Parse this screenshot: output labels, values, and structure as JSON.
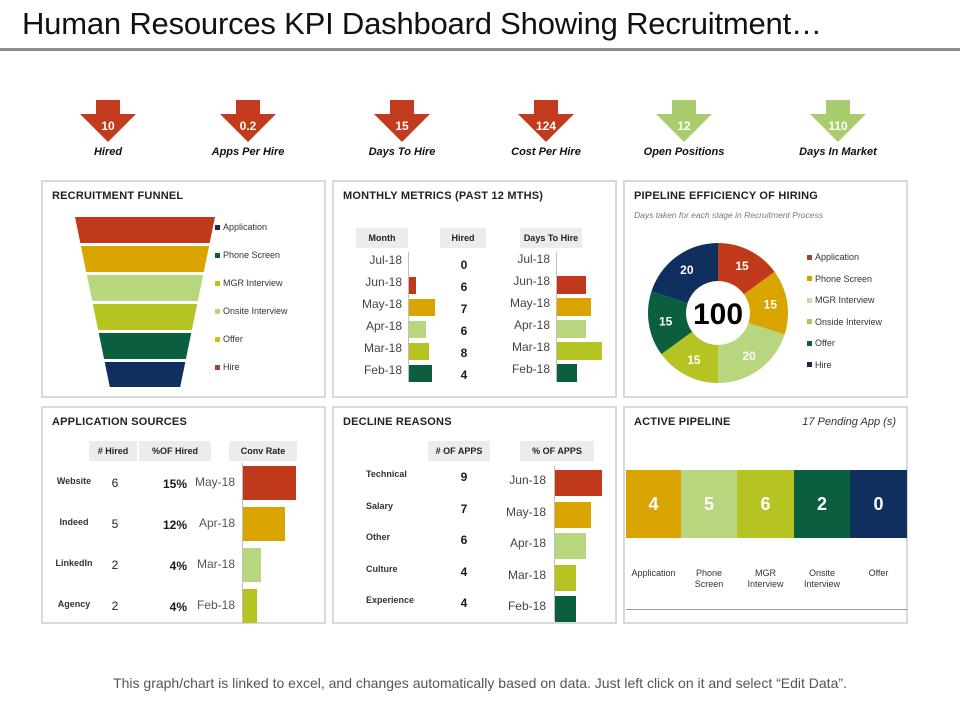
{
  "title": "Human Resources KPI Dashboard Showing Recruitment…",
  "colors": {
    "red": "#c0391b",
    "orange": "#d9a300",
    "lightgreen": "#b8d67e",
    "lime": "#b5c422",
    "darkgreen": "#0b5e3e",
    "navy": "#0f2f5e",
    "kpi_down_red": "#c23b1c",
    "kpi_down_green": "#a9cd6e"
  },
  "kpis": [
    {
      "value": "10",
      "label": "Hired",
      "color": "#c23b1c",
      "icon": "down-arrow-icon"
    },
    {
      "value": "0.2",
      "label": "Apps Per Hire",
      "color": "#c23b1c",
      "icon": "down-arrow-icon"
    },
    {
      "value": "15",
      "label": "Days To Hire",
      "color": "#c23b1c",
      "icon": "down-arrow-icon"
    },
    {
      "value": "124",
      "label": "Cost Per Hire",
      "color": "#c23b1c",
      "icon": "down-arrow-icon"
    },
    {
      "value": "12",
      "label": "Open Positions",
      "color": "#a9cd6e",
      "icon": "down-arrow-icon"
    },
    {
      "value": "110",
      "label": "Days In Market",
      "color": "#a9cd6e",
      "icon": "down-arrow-icon"
    }
  ],
  "funnel": {
    "title": "RECRUITMENT  FUNNEL",
    "stages": [
      "Application",
      "Phone Screen",
      "MGR Interview",
      "Onsite Interview",
      "Offer",
      "Hire"
    ],
    "stage_colors": [
      "#c0391b",
      "#d9a300",
      "#b8d67e",
      "#b5c422",
      "#0b5e3e",
      "#0f2f5e"
    ],
    "legend": [
      {
        "label": "Application",
        "color": "#1a2a3a"
      },
      {
        "label": "Phone Screen",
        "color": "#0b5e3e"
      },
      {
        "label": "MGR Interview",
        "color": "#b5c422"
      },
      {
        "label": "Onsite Interview",
        "color": "#b8d67e"
      },
      {
        "label": "Offer",
        "color": "#c9c222"
      },
      {
        "label": "Hire",
        "color": "#a04530"
      }
    ]
  },
  "monthly": {
    "title": "MONTHLY  METRICS  (PAST 12 MTHS)",
    "headers": {
      "month": "Month",
      "hired": "Hired",
      "days": "Days To  Hire"
    },
    "months": [
      "Jul-18",
      "Jun-18",
      "May-18",
      "Apr-18",
      "Mar-18",
      "Feb-18"
    ],
    "hired": [
      "0",
      "6",
      "7",
      "6",
      "8",
      "4"
    ],
    "bar_colors": [
      "#ffffff",
      "#c0391b",
      "#d9a300",
      "#b8d67e",
      "#b5c422",
      "#0b5e3e"
    ]
  },
  "pipeline_eff": {
    "title": "PIPELINE  EFFICIENCY  OF HIRING",
    "subtitle": "Days taken for each stage in Recruitment Process",
    "total": "100",
    "legend": [
      {
        "label": "Application",
        "color": "#a04530"
      },
      {
        "label": "Phone Screen",
        "color": "#c9a300"
      },
      {
        "label": "MGR Interview",
        "color": "#c9d9a9"
      },
      {
        "label": "Onside Interview",
        "color": "#b5c44a"
      },
      {
        "label": "Offer",
        "color": "#0b5e3e"
      },
      {
        "label": "Hire",
        "color": "#1a2a4a"
      }
    ]
  },
  "app_sources": {
    "title": "APPLICATION   SOURCES",
    "headers": {
      "hired": "# Hired",
      "pct": "%OF Hired",
      "conv": "Conv Rate"
    },
    "rows": [
      {
        "source": "Website",
        "hired": "6",
        "pct": "15%",
        "month": "May-18"
      },
      {
        "source": "Indeed",
        "hired": "5",
        "pct": "12%",
        "month": "Apr-18"
      },
      {
        "source": "LinkedIn",
        "hired": "2",
        "pct": "4%",
        "month": "Mar-18"
      },
      {
        "source": "Agency",
        "hired": "2",
        "pct": "4%",
        "month": "Feb-18"
      }
    ],
    "bar_colors": [
      "#c0391b",
      "#d9a300",
      "#b8d67e",
      "#b5c422"
    ]
  },
  "decline": {
    "title": "DECLINE   REASONS",
    "headers": {
      "apps": "# OF APPS",
      "pct": "% OF APPS"
    },
    "rows": [
      {
        "reason": "Technical",
        "apps": "9",
        "month": "Jun-18"
      },
      {
        "reason": "Salary",
        "apps": "7",
        "month": "May-18"
      },
      {
        "reason": "Other",
        "apps": "6",
        "month": "Apr-18"
      },
      {
        "reason": "Culture",
        "apps": "4",
        "month": "Mar-18"
      },
      {
        "reason": "Experience",
        "apps": "4",
        "month": "Feb-18"
      }
    ],
    "bar_colors": [
      "#c0391b",
      "#d9a300",
      "#b8d67e",
      "#b5c422",
      "#0b5e3e"
    ]
  },
  "active": {
    "title": "ACTIVE  PIPELINE",
    "pending": "17 Pending App (s)",
    "stages": [
      {
        "label": "Application",
        "value": "4",
        "color": "#d9a300"
      },
      {
        "label": "Phone\nScreen",
        "value": "5",
        "color": "#b8d67e"
      },
      {
        "label": "MGR\nInterview",
        "value": "6",
        "color": "#b5c422"
      },
      {
        "label": "Onsite\nInterview",
        "value": "2",
        "color": "#0b5e3e"
      },
      {
        "label": "Offer",
        "value": "0",
        "color": "#0f2f5e"
      }
    ]
  },
  "footer": "This graph/chart is linked to excel, and changes automatically  based on data. Just left click on it and select “Edit Data”.",
  "chart_data": [
    {
      "type": "bar",
      "title": "RECRUITMENT FUNNEL",
      "categories": [
        "Application",
        "Phone Screen",
        "MGR Interview",
        "Onsite Interview",
        "Offer",
        "Hire"
      ],
      "values": [
        100,
        90,
        80,
        70,
        60,
        50
      ],
      "note": "funnel; relative widths estimated"
    },
    {
      "type": "bar",
      "title": "MONTHLY METRICS (PAST 12 MTHS) - Hired",
      "categories": [
        "Jul-18",
        "Jun-18",
        "May-18",
        "Apr-18",
        "Mar-18",
        "Feb-18"
      ],
      "values": [
        0,
        6,
        7,
        6,
        8,
        4
      ],
      "bar_lengths_estimate": [
        0,
        2,
        8,
        5,
        6,
        7
      ]
    },
    {
      "type": "bar",
      "title": "MONTHLY METRICS (PAST 12 MTHS) - Days To Hire",
      "categories": [
        "Jul-18",
        "Jun-18",
        "May-18",
        "Apr-18",
        "Mar-18",
        "Feb-18"
      ],
      "values": [
        0,
        13,
        15,
        13,
        20,
        9
      ]
    },
    {
      "type": "pie",
      "title": "PIPELINE EFFICIENCY OF HIRING",
      "subtitle": "Days taken for each stage in Recruitment Process",
      "categories": [
        "Application",
        "Phone Screen",
        "MGR Interview",
        "Onside Interview",
        "Offer",
        "Hire"
      ],
      "values": [
        15,
        15,
        20,
        15,
        15,
        20
      ],
      "center_label": "100"
    },
    {
      "type": "bar",
      "title": "APPLICATION SOURCES - Conv Rate",
      "categories": [
        "May-18",
        "Apr-18",
        "Mar-18",
        "Feb-18"
      ],
      "values": [
        15,
        12,
        5,
        4
      ]
    },
    {
      "type": "bar",
      "title": "DECLINE REASONS - % OF APPS",
      "categories": [
        "Jun-18",
        "May-18",
        "Apr-18",
        "Mar-18",
        "Feb-18"
      ],
      "values": [
        9,
        7,
        6,
        4,
        4
      ]
    },
    {
      "type": "bar",
      "title": "ACTIVE PIPELINE",
      "categories": [
        "Application",
        "Phone Screen",
        "MGR Interview",
        "Onsite Interview",
        "Offer"
      ],
      "values": [
        4,
        5,
        6,
        2,
        0
      ]
    }
  ]
}
